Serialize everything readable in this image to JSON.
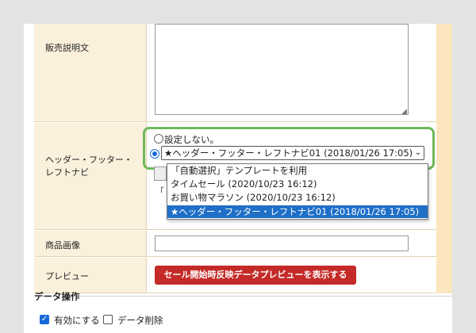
{
  "rows": {
    "description_label": "販売説明文",
    "header_footer_label_line1": "ヘッダー・フッター・",
    "header_footer_label_line2": "レフトナビ",
    "image_label": "商品画像",
    "preview_label": "プレビュー"
  },
  "header_footer": {
    "radio_none_label": "設定しない。",
    "selected_value": "★ヘッダー・フッター・レフトナビ01 (2018/01/26 17:05)",
    "options": [
      "「自動選択」テンプレートを利用",
      "タイムセール (2020/10/23 16:12)",
      "お買い物マラソン (2020/10/23 16:12)",
      "★ヘッダー・フッター・レフトナビ01 (2018/01/26 17:05)"
    ],
    "behind_text": "「"
  },
  "preview": {
    "button_label": "セール開始時反映データプレビューを表示する"
  },
  "data_ops": {
    "title": "データ操作",
    "enable_label": "有効にする",
    "delete_label": "データ削除"
  },
  "icons": {
    "chevron": "chevron-down-icon",
    "check": "checkmark-icon"
  },
  "colors": {
    "accent_green": "#6db858",
    "button_red": "#c42a28",
    "selected_blue": "#1f6fc7",
    "label_bg": "#fbf0dc"
  }
}
